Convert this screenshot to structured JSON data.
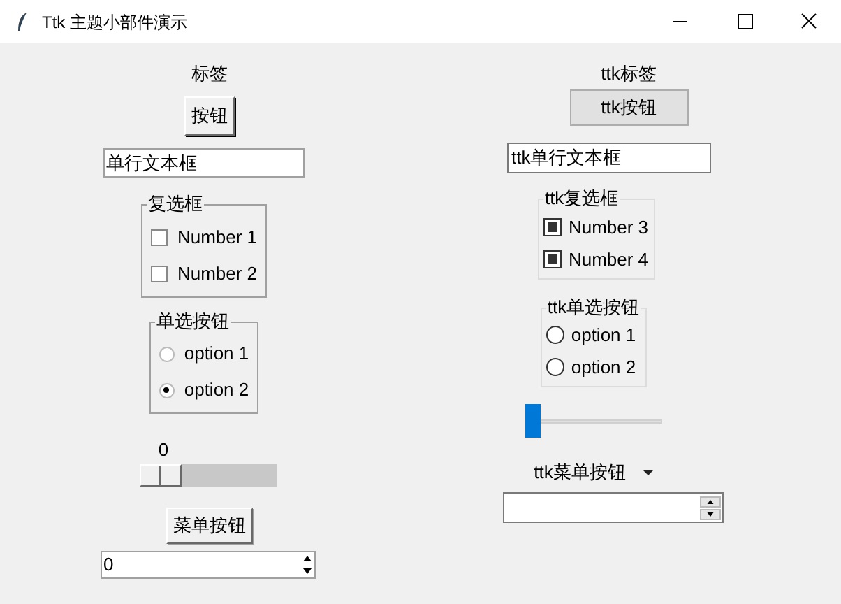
{
  "window": {
    "title": "Ttk 主题小部件演示"
  },
  "tk": {
    "label": "标签",
    "button": "按钮",
    "entry": "单行文本框",
    "checkframe": {
      "title": "复选框",
      "items": [
        {
          "label": "Number 1",
          "checked": false
        },
        {
          "label": "Number 2",
          "checked": false
        }
      ]
    },
    "radioframe": {
      "title": "单选按钮",
      "items": [
        {
          "label": "option 1",
          "selected": false
        },
        {
          "label": "option 2",
          "selected": true
        }
      ]
    },
    "scale": {
      "reading": "0",
      "level": 0
    },
    "menubutton": "菜单按钮",
    "spinbox": "0"
  },
  "ttk": {
    "label": "ttk标签",
    "button": "ttk按钮",
    "entry": "ttk单行文本框",
    "checkframe": {
      "title": "ttk复选框",
      "items": [
        {
          "label": "Number 3",
          "checked": true
        },
        {
          "label": "Number 4",
          "checked": true
        }
      ]
    },
    "radioframe": {
      "title": "ttk单选按钮",
      "items": [
        {
          "label": "option 1",
          "selected": false
        },
        {
          "label": "option 2",
          "selected": false
        }
      ]
    },
    "scale": {
      "level": 0
    },
    "menubutton": "ttk菜单按钮"
  }
}
